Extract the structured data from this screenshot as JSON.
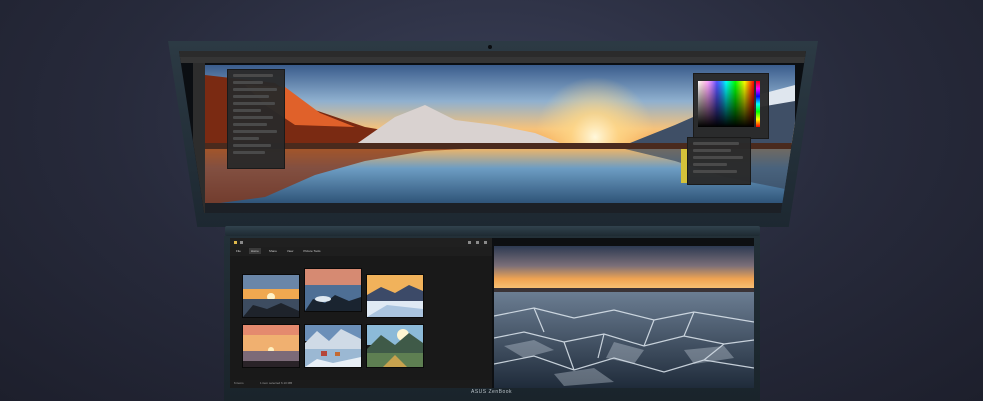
{
  "device": {
    "brand_label": "ASUS ZenBook"
  },
  "colors": {
    "background": "#272a3b",
    "chassis": "#233038",
    "sunset_orange": "#f2a23c",
    "lake_blue": "#3f7fae"
  },
  "top_screen": {
    "app": "photo-editor",
    "panels": [
      "adjustments-panel",
      "color-picker-panel",
      "layers-panel"
    ]
  },
  "bottom_screen": {
    "explorer": {
      "ribbon_tabs": [
        "File",
        "Home",
        "Share",
        "View",
        "Picture Tools"
      ],
      "active_tab": "Home",
      "status_items": "6 items",
      "status_selected": "1 item selected  6.10 MB",
      "thumbnails": [
        "sunset-rocks",
        "icy-shore",
        "snow-valley",
        "pink-dusk",
        "frozen-village",
        "mountain-lake"
      ]
    },
    "viewer": {
      "image": "frozen-lake-sunset"
    }
  }
}
